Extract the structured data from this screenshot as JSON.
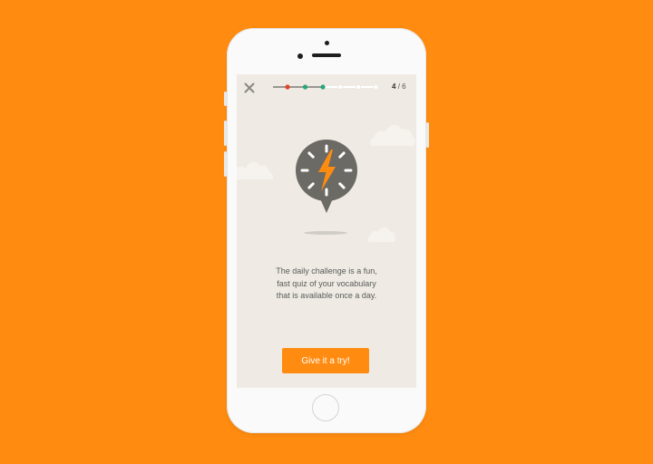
{
  "quiz": {
    "current_step": "4",
    "total_steps": "/ 6",
    "progress": {
      "completed": 3,
      "total": 6,
      "markers": [
        "wrong",
        "correct",
        "correct",
        "pending",
        "pending",
        "pending"
      ]
    }
  },
  "description": {
    "lines": [
      "The daily challenge is a fun,",
      "fast quiz of your vocabulary",
      "that is available once a day."
    ]
  },
  "cta": {
    "label": "Give it a try!"
  },
  "icons": {
    "close": "close-icon",
    "badge": "lightning-stopwatch-icon",
    "home": "home-button"
  },
  "colors": {
    "background": "#FF8C10",
    "accent": "#FF8C10",
    "correct": "#2BA678",
    "wrong": "#E0442A",
    "badge": "#6B6A64",
    "screen": "#EFEBE4"
  }
}
